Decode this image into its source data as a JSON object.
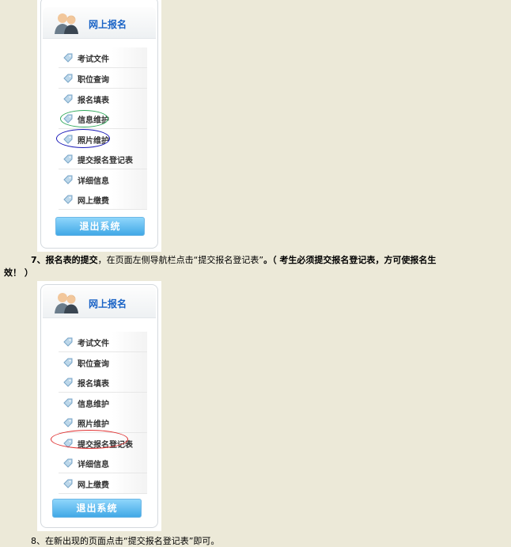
{
  "panel1": {
    "title": "网上报名",
    "menu": [
      "考试文件",
      "职位查询",
      "报名填表",
      "信息维护",
      "照片维护",
      "提交报名登记表",
      "详细信息",
      "网上缴费"
    ],
    "logout": "退出系统",
    "highlight_colors": {
      "信息维护": "#2fa85a",
      "照片维护": "#1a1ab8"
    }
  },
  "step7": {
    "num": "7、",
    "bold1": "报名表的提交",
    "sep": "，",
    "text1": "在页面左侧导航栏点击",
    "quoted": "“提交报名登记表”",
    "end": "。",
    "note_line1": "（ 考生必须提交报名登记表，方可使报名生",
    "note_line2": "效！ ）"
  },
  "panel2": {
    "title": "网上报名",
    "menu": [
      "考试文件",
      "职位查询",
      "报名填表",
      "信息维护",
      "照片维护",
      "提交报名登记表",
      "详细信息",
      "网上缴费"
    ],
    "logout": "退出系统",
    "highlight_colors": {
      "提交报名登记表": "#e03030"
    }
  },
  "step8": {
    "text": "8、在新出现的页面点击“提交报名登记表”即可。"
  }
}
